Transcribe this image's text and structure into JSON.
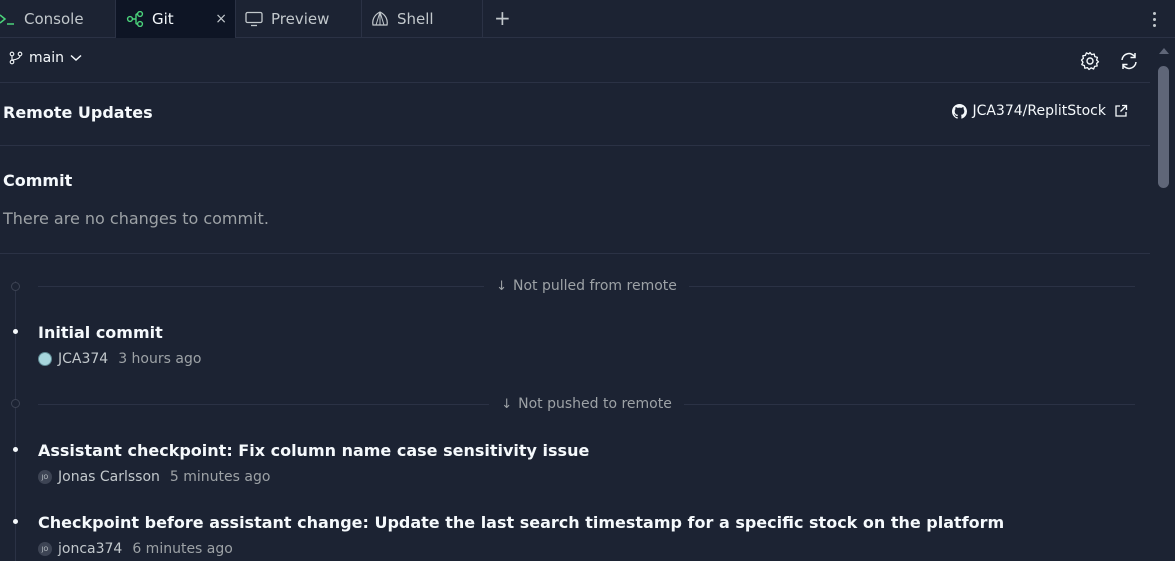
{
  "tabs": [
    {
      "label": "Console",
      "icon": "console-icon"
    },
    {
      "label": "Git",
      "icon": "git-icon",
      "active": true,
      "close": "×"
    },
    {
      "label": "Preview",
      "icon": "monitor-icon"
    },
    {
      "label": "Shell",
      "icon": "shell-icon"
    }
  ],
  "add_tab": "+",
  "toolbar": {
    "branch": "main",
    "settings_icon": "gear-icon",
    "refresh_icon": "refresh-icon"
  },
  "remote": {
    "title": "Remote Updates",
    "repo": "JCA374/ReplitStock"
  },
  "commit": {
    "title": "Commit",
    "empty_message": "There are no changes to commit."
  },
  "history": {
    "not_pulled_label": "Not pulled from remote",
    "not_pushed_label": "Not pushed to remote",
    "arrow": "↓",
    "commits": [
      {
        "title": "Initial commit",
        "author": "JCA374",
        "initials": "",
        "time": "3 hours ago"
      },
      {
        "title": "Assistant checkpoint: Fix column name case sensitivity issue",
        "author": "Jonas Carlsson",
        "initials": "JO",
        "time": "5 minutes ago"
      },
      {
        "title": "Checkpoint before assistant change: Update the last search timestamp for a specific stock on the platform",
        "author": "jonca374",
        "initials": "JO",
        "time": "6 minutes ago"
      }
    ]
  },
  "colors": {
    "background": "#1c2333",
    "active_tab": "#0e1525",
    "border": "#2b3245",
    "text": "#f5f9fc",
    "muted": "#9da2a6",
    "git_green": "#4bd37b"
  }
}
